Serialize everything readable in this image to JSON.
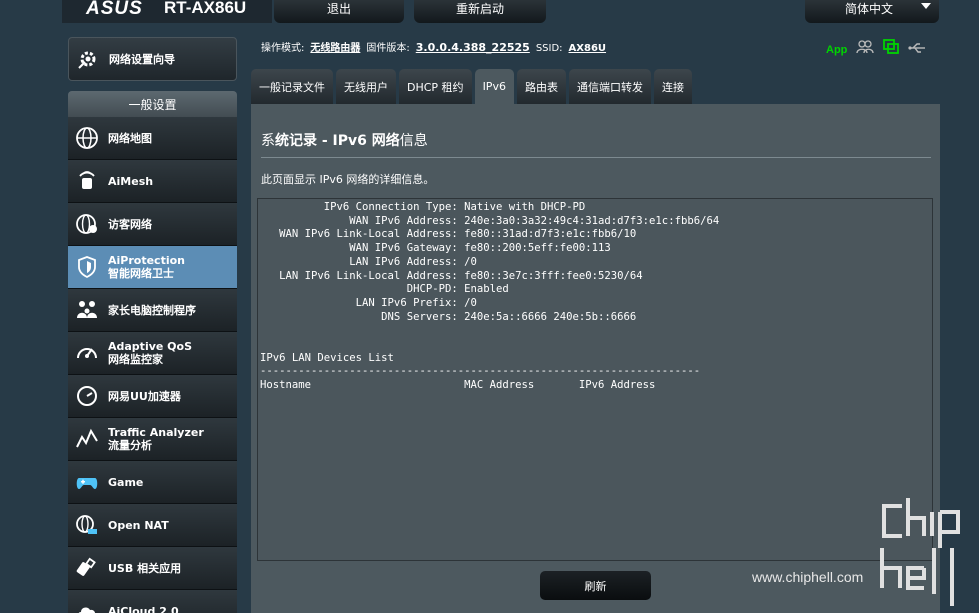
{
  "brand": {
    "logo": "ASUS",
    "model": "RT-AX86U"
  },
  "topbar": {
    "logout": "退出",
    "reboot": "重新启动",
    "language": "简体中文"
  },
  "sidebar": {
    "quick_setup": "网络设置向导",
    "section_header": "一般设置",
    "items": [
      {
        "label": "网络地图",
        "sub": "",
        "icon": "globe-network-icon"
      },
      {
        "label": "AiMesh",
        "sub": "",
        "icon": "aimesh-icon"
      },
      {
        "label": "访客网络",
        "sub": "",
        "icon": "guest-network-icon"
      },
      {
        "label": "AiProtection",
        "sub": "智能网络卫士",
        "icon": "shield-icon"
      },
      {
        "label": "家长电脑控制程序",
        "sub": "",
        "icon": "family-icon"
      },
      {
        "label": "Adaptive QoS",
        "sub": "网络监控家",
        "icon": "speedometer-icon"
      },
      {
        "label": "网易UU加速器",
        "sub": "",
        "icon": "gauge-icon"
      },
      {
        "label": "Traffic Analyzer",
        "sub": "流量分析",
        "icon": "traffic-chart-icon"
      },
      {
        "label": "Game",
        "sub": "",
        "icon": "gamepad-icon"
      },
      {
        "label": "Open NAT",
        "sub": "",
        "icon": "globe-gamepad-icon"
      },
      {
        "label": "USB 相关应用",
        "sub": "",
        "icon": "usb-icon"
      },
      {
        "label": "AiCloud 2.0",
        "sub": "",
        "icon": "cloud-icon"
      }
    ]
  },
  "infobar": {
    "mode_label": "操作模式:",
    "mode_value": "无线路由器",
    "fw_label": "固件版本:",
    "fw_value": "3.0.0.4.388_22525",
    "ssid_label": "SSID:",
    "ssid_value": "AX86U",
    "app_label": "App"
  },
  "tabs": [
    {
      "label": "一般记录文件",
      "active": false
    },
    {
      "label": "无线用户",
      "active": false
    },
    {
      "label": "DHCP 租约",
      "active": false
    },
    {
      "label": "IPv6",
      "active": true
    },
    {
      "label": "路由表",
      "active": false
    },
    {
      "label": "通信端口转发",
      "active": false
    },
    {
      "label": "连接",
      "active": false
    }
  ],
  "page": {
    "title_prefix": "系",
    "title_bold": "统记录 - IPv6 网络",
    "title_suffix": "信息",
    "description": "此页面显示 IPv6 网络的详细信息。",
    "log": "          IPv6 Connection Type: Native with DHCP-PD\n              WAN IPv6 Address: 240e:3a0:3a32:49c4:31ad:d7f3:e1c:fbb6/64\n   WAN IPv6 Link-Local Address: fe80::31ad:d7f3:e1c:fbb6/10\n              WAN IPv6 Gateway: fe80::200:5eff:fe00:113\n              LAN IPv6 Address: /0\n   LAN IPv6 Link-Local Address: fe80::3e7c:3fff:fee0:5230/64\n                       DHCP-PD: Enabled\n               LAN IPv6 Prefix: /0\n                   DNS Servers: 240e:5a::6666 240e:5b::6666\n\n\nIPv6 LAN Devices List\n---------------------------------------------------------------------\nHostname                        MAC Address       IPv6 Address",
    "refresh": "刷新"
  },
  "watermark": {
    "url": "www.chiphell.com"
  }
}
